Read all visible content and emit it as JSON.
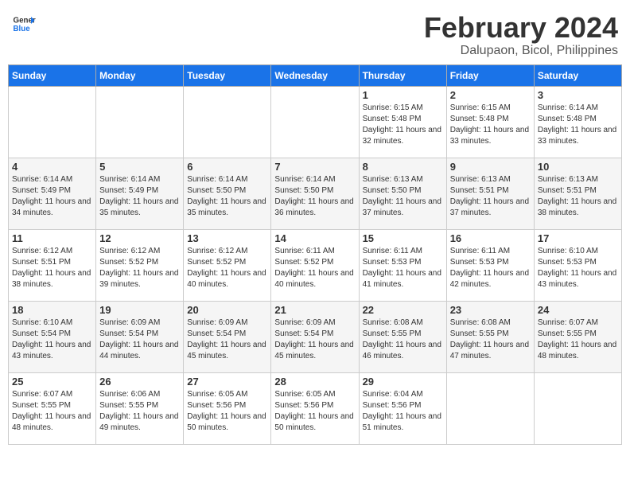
{
  "logo": {
    "line1": "General",
    "line2": "Blue"
  },
  "title": "February 2024",
  "location": "Dalupaon, Bicol, Philippines",
  "days_of_week": [
    "Sunday",
    "Monday",
    "Tuesday",
    "Wednesday",
    "Thursday",
    "Friday",
    "Saturday"
  ],
  "weeks": [
    [
      {
        "day": "",
        "info": ""
      },
      {
        "day": "",
        "info": ""
      },
      {
        "day": "",
        "info": ""
      },
      {
        "day": "",
        "info": ""
      },
      {
        "day": "1",
        "info": "Sunrise: 6:15 AM\nSunset: 5:48 PM\nDaylight: 11 hours and 32 minutes."
      },
      {
        "day": "2",
        "info": "Sunrise: 6:15 AM\nSunset: 5:48 PM\nDaylight: 11 hours and 33 minutes."
      },
      {
        "day": "3",
        "info": "Sunrise: 6:14 AM\nSunset: 5:48 PM\nDaylight: 11 hours and 33 minutes."
      }
    ],
    [
      {
        "day": "4",
        "info": "Sunrise: 6:14 AM\nSunset: 5:49 PM\nDaylight: 11 hours and 34 minutes."
      },
      {
        "day": "5",
        "info": "Sunrise: 6:14 AM\nSunset: 5:49 PM\nDaylight: 11 hours and 35 minutes."
      },
      {
        "day": "6",
        "info": "Sunrise: 6:14 AM\nSunset: 5:50 PM\nDaylight: 11 hours and 35 minutes."
      },
      {
        "day": "7",
        "info": "Sunrise: 6:14 AM\nSunset: 5:50 PM\nDaylight: 11 hours and 36 minutes."
      },
      {
        "day": "8",
        "info": "Sunrise: 6:13 AM\nSunset: 5:50 PM\nDaylight: 11 hours and 37 minutes."
      },
      {
        "day": "9",
        "info": "Sunrise: 6:13 AM\nSunset: 5:51 PM\nDaylight: 11 hours and 37 minutes."
      },
      {
        "day": "10",
        "info": "Sunrise: 6:13 AM\nSunset: 5:51 PM\nDaylight: 11 hours and 38 minutes."
      }
    ],
    [
      {
        "day": "11",
        "info": "Sunrise: 6:12 AM\nSunset: 5:51 PM\nDaylight: 11 hours and 38 minutes."
      },
      {
        "day": "12",
        "info": "Sunrise: 6:12 AM\nSunset: 5:52 PM\nDaylight: 11 hours and 39 minutes."
      },
      {
        "day": "13",
        "info": "Sunrise: 6:12 AM\nSunset: 5:52 PM\nDaylight: 11 hours and 40 minutes."
      },
      {
        "day": "14",
        "info": "Sunrise: 6:11 AM\nSunset: 5:52 PM\nDaylight: 11 hours and 40 minutes."
      },
      {
        "day": "15",
        "info": "Sunrise: 6:11 AM\nSunset: 5:53 PM\nDaylight: 11 hours and 41 minutes."
      },
      {
        "day": "16",
        "info": "Sunrise: 6:11 AM\nSunset: 5:53 PM\nDaylight: 11 hours and 42 minutes."
      },
      {
        "day": "17",
        "info": "Sunrise: 6:10 AM\nSunset: 5:53 PM\nDaylight: 11 hours and 43 minutes."
      }
    ],
    [
      {
        "day": "18",
        "info": "Sunrise: 6:10 AM\nSunset: 5:54 PM\nDaylight: 11 hours and 43 minutes."
      },
      {
        "day": "19",
        "info": "Sunrise: 6:09 AM\nSunset: 5:54 PM\nDaylight: 11 hours and 44 minutes."
      },
      {
        "day": "20",
        "info": "Sunrise: 6:09 AM\nSunset: 5:54 PM\nDaylight: 11 hours and 45 minutes."
      },
      {
        "day": "21",
        "info": "Sunrise: 6:09 AM\nSunset: 5:54 PM\nDaylight: 11 hours and 45 minutes."
      },
      {
        "day": "22",
        "info": "Sunrise: 6:08 AM\nSunset: 5:55 PM\nDaylight: 11 hours and 46 minutes."
      },
      {
        "day": "23",
        "info": "Sunrise: 6:08 AM\nSunset: 5:55 PM\nDaylight: 11 hours and 47 minutes."
      },
      {
        "day": "24",
        "info": "Sunrise: 6:07 AM\nSunset: 5:55 PM\nDaylight: 11 hours and 48 minutes."
      }
    ],
    [
      {
        "day": "25",
        "info": "Sunrise: 6:07 AM\nSunset: 5:55 PM\nDaylight: 11 hours and 48 minutes."
      },
      {
        "day": "26",
        "info": "Sunrise: 6:06 AM\nSunset: 5:55 PM\nDaylight: 11 hours and 49 minutes."
      },
      {
        "day": "27",
        "info": "Sunrise: 6:05 AM\nSunset: 5:56 PM\nDaylight: 11 hours and 50 minutes."
      },
      {
        "day": "28",
        "info": "Sunrise: 6:05 AM\nSunset: 5:56 PM\nDaylight: 11 hours and 50 minutes."
      },
      {
        "day": "29",
        "info": "Sunrise: 6:04 AM\nSunset: 5:56 PM\nDaylight: 11 hours and 51 minutes."
      },
      {
        "day": "",
        "info": ""
      },
      {
        "day": "",
        "info": ""
      }
    ]
  ]
}
